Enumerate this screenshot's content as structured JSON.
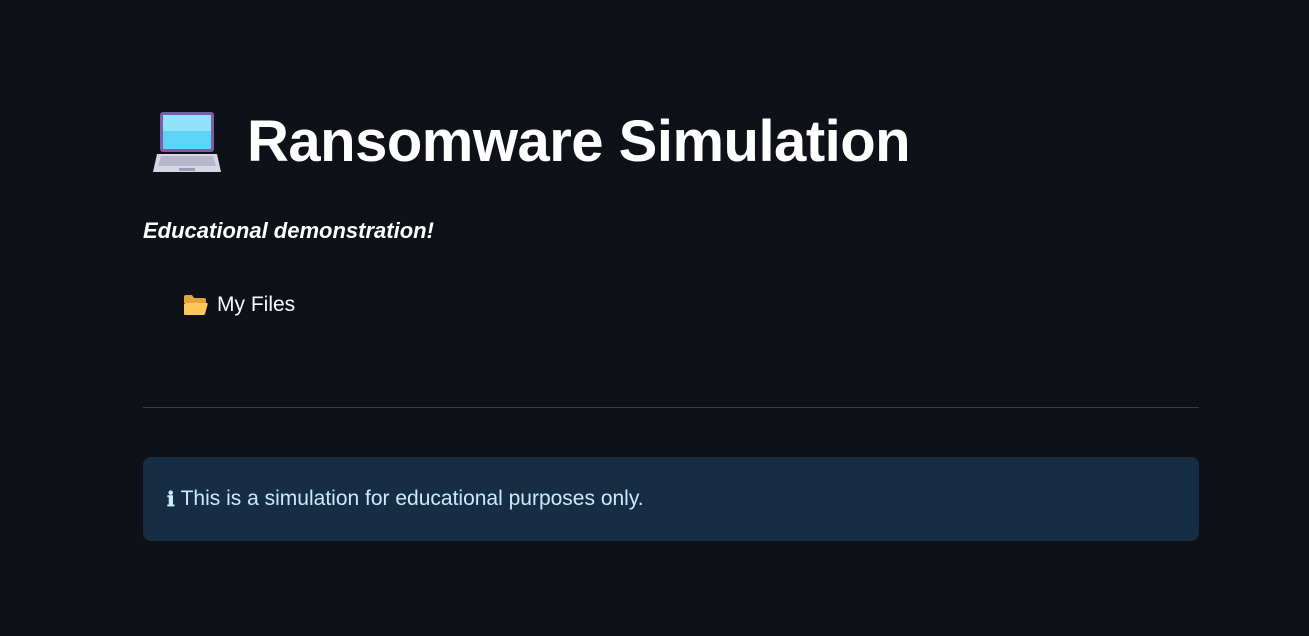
{
  "header": {
    "title": "Ransomware Simulation",
    "title_icon": "laptop-icon",
    "subtitle": "Educational demonstration!"
  },
  "files": {
    "label": "My Files",
    "icon": "folder-open-icon"
  },
  "info": {
    "icon": "information-icon",
    "icon_glyph": "ℹ",
    "message": "This is a simulation for educational purposes only."
  },
  "colors": {
    "background": "#0e1117",
    "info_background": "#172d43",
    "info_text": "#c7ebff",
    "divider": "#3a3d45"
  }
}
